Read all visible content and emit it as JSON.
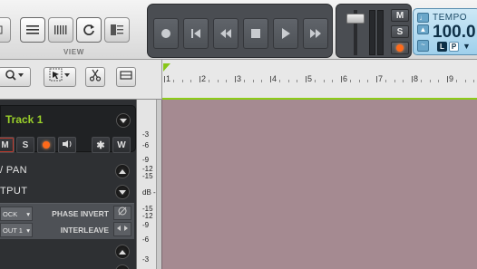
{
  "view_toolbar": {
    "label": "VIEW",
    "buttons": [
      {
        "name": "list-view-icon"
      },
      {
        "name": "mixer-view-icon"
      },
      {
        "name": "loop-view-icon"
      },
      {
        "name": "browser-view-icon"
      }
    ]
  },
  "transport": {
    "buttons": [
      {
        "name": "record-icon"
      },
      {
        "name": "rewind-to-start-icon"
      },
      {
        "name": "rewind-icon"
      },
      {
        "name": "stop-icon"
      },
      {
        "name": "play-icon"
      },
      {
        "name": "fast-forward-icon"
      }
    ]
  },
  "master": {
    "mute_label": "M",
    "solo_label": "S"
  },
  "tempo": {
    "label": "TEMPO",
    "value": "100.0",
    "l_label": "L",
    "p_label": "P"
  },
  "ruler": {
    "bars": [
      "1",
      "2",
      "3",
      "4",
      "5",
      "6",
      "7",
      "8",
      "9"
    ]
  },
  "track": {
    "name": "Track 1",
    "mute_label": "M",
    "solo_label": "S",
    "w_label": "W"
  },
  "sections": {
    "volume_pan": "/ PAN",
    "output": "TPUT"
  },
  "io": {
    "clock_dropdown": "OCK",
    "output_dropdown": "OUT 1",
    "phase_invert_label": "PHASE INVERT",
    "interleave_label": "INTERLEAVE"
  },
  "level_scale": [
    "-3",
    "-6",
    "-9",
    "-12",
    "-15",
    "dB -",
    "-15",
    "-12",
    "-9",
    "-6",
    "-3"
  ],
  "colors": {
    "track_name": "#9ad02a",
    "record_orange": "#ff6a1a",
    "arrange_bg": "#a58a91",
    "tempo_bg": "#b9def1",
    "ruler_green": "#8ccc18"
  }
}
